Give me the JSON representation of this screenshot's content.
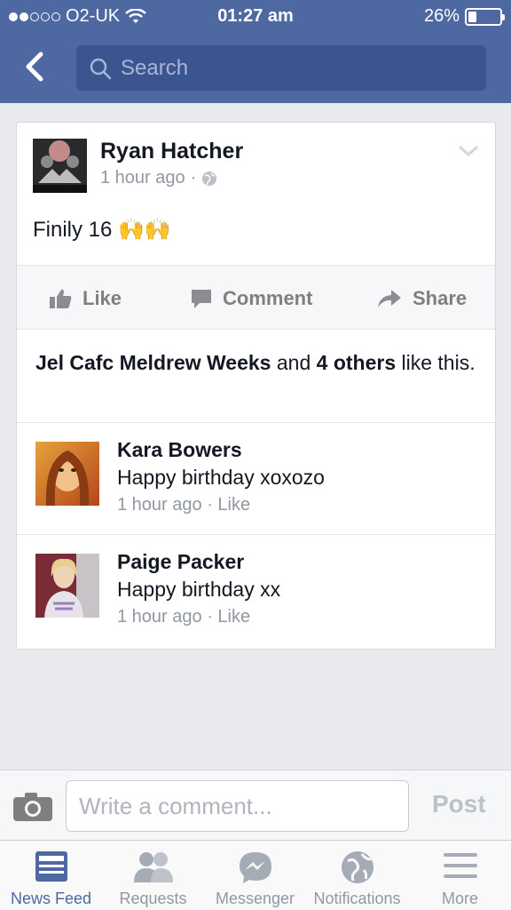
{
  "status_bar": {
    "carrier": "O2-UK",
    "time": "01:27 am",
    "battery": "26%",
    "battery_level": 0.26
  },
  "search": {
    "placeholder": "Search"
  },
  "post": {
    "author": "Ryan Hatcher",
    "time": "1 hour ago",
    "separator": "·",
    "text": "Finily 16",
    "emoji": "🙌🙌",
    "actions": {
      "like": "Like",
      "comment": "Comment",
      "share": "Share"
    },
    "likes": {
      "names": "Jel Cafc Meldrew Weeks",
      "and": "and",
      "others": "4 others",
      "suffix": "like this."
    }
  },
  "comments": [
    {
      "name": "Kara Bowers",
      "text": "Happy birthday xoxozo",
      "time": "1 hour ago",
      "sep": " · ",
      "like": "Like"
    },
    {
      "name": "Paige Packer",
      "text": "Happy birthday xx",
      "time": "1 hour ago",
      "sep": " · ",
      "like": "Like"
    }
  ],
  "composer": {
    "placeholder": "Write a comment...",
    "post": "Post"
  },
  "tabbar": {
    "tabs": [
      {
        "label": "News Feed",
        "icon": "news-feed-icon"
      },
      {
        "label": "Requests",
        "icon": "friend-requests-icon"
      },
      {
        "label": "Messenger",
        "icon": "messenger-icon"
      },
      {
        "label": "Notifications",
        "icon": "globe-icon"
      },
      {
        "label": "More",
        "icon": "menu-icon"
      }
    ]
  },
  "colors": {
    "header": "#4e69a2",
    "search_box": "#3b5591",
    "active_tab": "#4e69a2",
    "muted": "#9197a3"
  }
}
